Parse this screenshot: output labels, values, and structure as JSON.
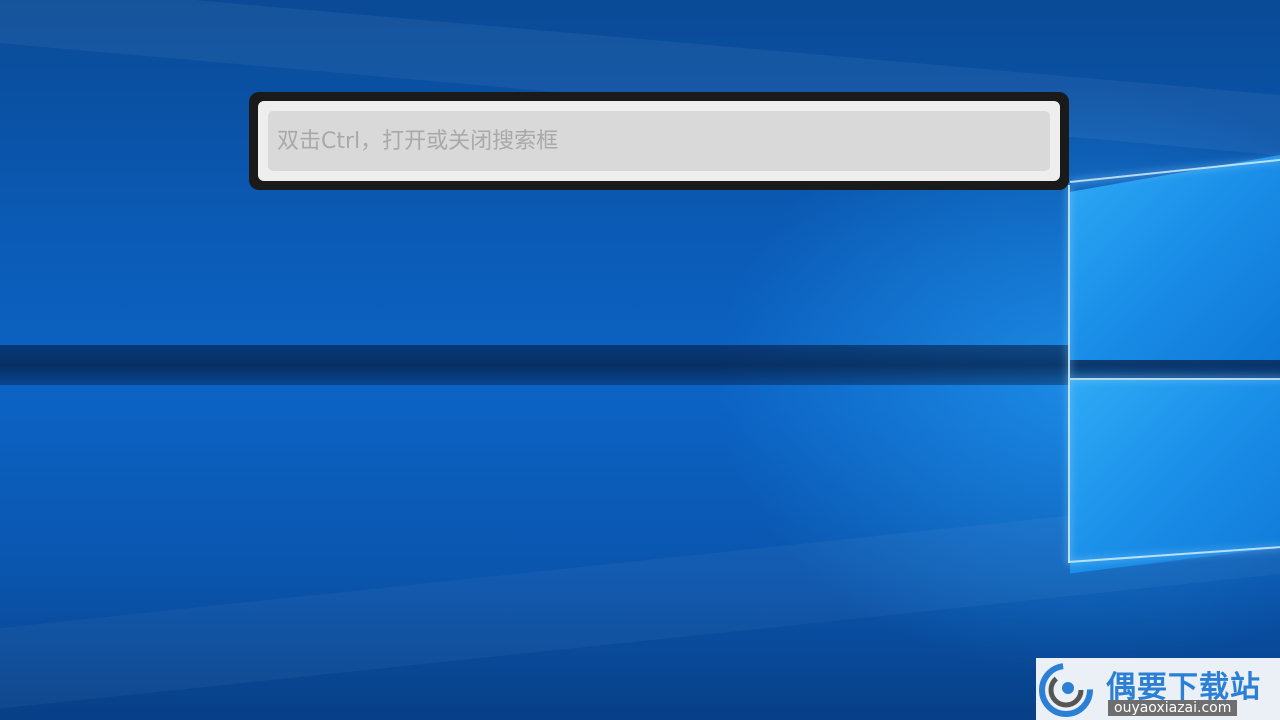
{
  "search": {
    "placeholder": "双击Ctrl，打开或关闭搜索框",
    "value": ""
  },
  "watermark": {
    "title": "偶要下载站",
    "url": "ouyaoxiazai.com",
    "icon": "swirl-logo-icon"
  },
  "colors": {
    "frame": "#1a1a1a",
    "inner": "#eeeeee",
    "input_bg": "#d9d9d9",
    "placeholder": "#a9a9a9",
    "desktop_blue": "#0a57b0",
    "watermark_blue": "#2b7fd4"
  }
}
